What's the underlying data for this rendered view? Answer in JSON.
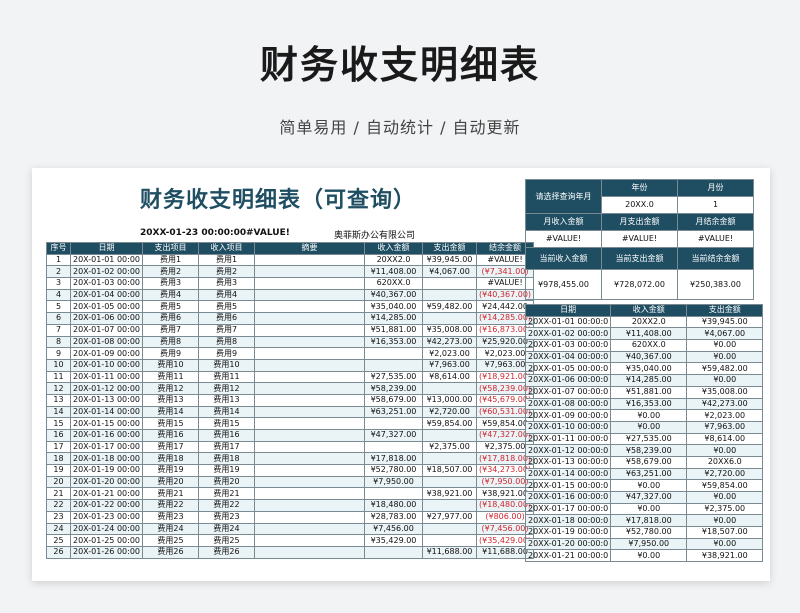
{
  "header": {
    "title": "财务收支明细表",
    "subtitle": "简单易用 / 自动统计 / 自动更新"
  },
  "sheet": {
    "title": "财务收支明细表（可查询）",
    "date": "20XX-01-23 00:00:00",
    "error": "#VALUE!",
    "company": "奥菲斯办公有限公司"
  },
  "main_headers": [
    "序号",
    "日期",
    "支出项目",
    "收入项目",
    "摘要",
    "收入金额",
    "支出金额",
    "结余金额"
  ],
  "rows": [
    {
      "no": "1",
      "date": "20X-01-01 00:00",
      "exp": "费用1",
      "inc": "费用1",
      "memo": "",
      "income": "20XX2.0",
      "expense": "¥39,945.00",
      "balance": "#VALUE!",
      "neg": false
    },
    {
      "no": "2",
      "date": "20X-01-02 00:00",
      "exp": "费用2",
      "inc": "费用2",
      "memo": "",
      "income": "¥11,408.00",
      "expense": "¥4,067.00",
      "balance": "(¥7,341.00)",
      "neg": true
    },
    {
      "no": "3",
      "date": "20X-01-03 00:00",
      "exp": "费用3",
      "inc": "费用3",
      "memo": "",
      "income": "620XX.0",
      "expense": "",
      "balance": "#VALUE!",
      "neg": false
    },
    {
      "no": "4",
      "date": "20X-01-04 00:00",
      "exp": "费用4",
      "inc": "费用4",
      "memo": "",
      "income": "¥40,367.00",
      "expense": "",
      "balance": "(¥40,367.00)",
      "neg": true
    },
    {
      "no": "5",
      "date": "20X-01-05 00:00",
      "exp": "费用5",
      "inc": "费用5",
      "memo": "",
      "income": "¥35,040.00",
      "expense": "¥59,482.00",
      "balance": "¥24,442.00",
      "neg": false
    },
    {
      "no": "6",
      "date": "20X-01-06 00:00",
      "exp": "费用6",
      "inc": "费用6",
      "memo": "",
      "income": "¥14,285.00",
      "expense": "",
      "balance": "(¥14,285.00)",
      "neg": true
    },
    {
      "no": "7",
      "date": "20X-01-07 00:00",
      "exp": "费用7",
      "inc": "费用7",
      "memo": "",
      "income": "¥51,881.00",
      "expense": "¥35,008.00",
      "balance": "(¥16,873.00)",
      "neg": true
    },
    {
      "no": "8",
      "date": "20X-01-08 00:00",
      "exp": "费用8",
      "inc": "费用8",
      "memo": "",
      "income": "¥16,353.00",
      "expense": "¥42,273.00",
      "balance": "¥25,920.00",
      "neg": false
    },
    {
      "no": "9",
      "date": "20X-01-09 00:00",
      "exp": "费用9",
      "inc": "费用9",
      "memo": "",
      "income": "",
      "expense": "¥2,023.00",
      "balance": "¥2,023.00",
      "neg": false
    },
    {
      "no": "10",
      "date": "20X-01-10 00:00",
      "exp": "费用10",
      "inc": "费用10",
      "memo": "",
      "income": "",
      "expense": "¥7,963.00",
      "balance": "¥7,963.00",
      "neg": false
    },
    {
      "no": "11",
      "date": "20X-01-11 00:00",
      "exp": "费用11",
      "inc": "费用11",
      "memo": "",
      "income": "¥27,535.00",
      "expense": "¥8,614.00",
      "balance": "(¥18,921.00)",
      "neg": true
    },
    {
      "no": "12",
      "date": "20X-01-12 00:00",
      "exp": "费用12",
      "inc": "费用12",
      "memo": "",
      "income": "¥58,239.00",
      "expense": "",
      "balance": "(¥58,239.00)",
      "neg": true
    },
    {
      "no": "13",
      "date": "20X-01-13 00:00",
      "exp": "费用13",
      "inc": "费用13",
      "memo": "",
      "income": "¥58,679.00",
      "expense": "¥13,000.00",
      "balance": "(¥45,679.00)",
      "neg": true
    },
    {
      "no": "14",
      "date": "20X-01-14 00:00",
      "exp": "费用14",
      "inc": "费用14",
      "memo": "",
      "income": "¥63,251.00",
      "expense": "¥2,720.00",
      "balance": "(¥60,531.00)",
      "neg": true
    },
    {
      "no": "15",
      "date": "20X-01-15 00:00",
      "exp": "费用15",
      "inc": "费用15",
      "memo": "",
      "income": "",
      "expense": "¥59,854.00",
      "balance": "¥59,854.00",
      "neg": false
    },
    {
      "no": "16",
      "date": "20X-01-16 00:00",
      "exp": "费用16",
      "inc": "费用16",
      "memo": "",
      "income": "¥47,327.00",
      "expense": "",
      "balance": "(¥47,327.00)",
      "neg": true
    },
    {
      "no": "17",
      "date": "20X-01-17 00:00",
      "exp": "费用17",
      "inc": "费用17",
      "memo": "",
      "income": "",
      "expense": "¥2,375.00",
      "balance": "¥2,375.00",
      "neg": false
    },
    {
      "no": "18",
      "date": "20X-01-18 00:00",
      "exp": "费用18",
      "inc": "费用18",
      "memo": "",
      "income": "¥17,818.00",
      "expense": "",
      "balance": "(¥17,818.00)",
      "neg": true
    },
    {
      "no": "19",
      "date": "20X-01-19 00:00",
      "exp": "费用19",
      "inc": "费用19",
      "memo": "",
      "income": "¥52,780.00",
      "expense": "¥18,507.00",
      "balance": "(¥34,273.00)",
      "neg": true
    },
    {
      "no": "20",
      "date": "20X-01-20 00:00",
      "exp": "费用20",
      "inc": "费用20",
      "memo": "",
      "income": "¥7,950.00",
      "expense": "",
      "balance": "(¥7,950.00)",
      "neg": true
    },
    {
      "no": "21",
      "date": "20X-01-21 00:00",
      "exp": "费用21",
      "inc": "费用21",
      "memo": "",
      "income": "",
      "expense": "¥38,921.00",
      "balance": "¥38,921.00",
      "neg": false
    },
    {
      "no": "22",
      "date": "20X-01-22 00:00",
      "exp": "费用22",
      "inc": "费用22",
      "memo": "",
      "income": "¥18,480.00",
      "expense": "",
      "balance": "(¥18,480.00)",
      "neg": true
    },
    {
      "no": "23",
      "date": "20X-01-23 00:00",
      "exp": "费用23",
      "inc": "费用23",
      "memo": "",
      "income": "¥28,783.00",
      "expense": "¥27,977.00",
      "balance": "(¥806.00)",
      "neg": true
    },
    {
      "no": "24",
      "date": "20X-01-24 00:00",
      "exp": "费用24",
      "inc": "费用24",
      "memo": "",
      "income": "¥7,456.00",
      "expense": "",
      "balance": "(¥7,456.00)",
      "neg": true
    },
    {
      "no": "25",
      "date": "20X-01-25 00:00",
      "exp": "费用25",
      "inc": "费用25",
      "memo": "",
      "income": "¥35,429.00",
      "expense": "",
      "balance": "(¥35,429.00)",
      "neg": true
    },
    {
      "no": "26",
      "date": "20X-01-26 00:00",
      "exp": "费用26",
      "inc": "费用26",
      "memo": "",
      "income": "",
      "expense": "¥11,688.00",
      "balance": "¥11,688.00",
      "neg": false
    }
  ],
  "query": {
    "label": "请选择查询年月",
    "year_label": "年份",
    "month_label": "月份",
    "year": "20XX.0",
    "month": "1",
    "month_income_label": "月收入金额",
    "month_expense_label": "月支出金额",
    "month_balance_label": "月结余金额",
    "month_income": "#VALUE!",
    "month_expense": "#VALUE!",
    "month_balance": "#VALUE!",
    "cur_income_label": "当前收入金额",
    "cur_expense_label": "当前支出金额",
    "cur_balance_label": "当前结余金额",
    "cur_income": "¥978,455.00",
    "cur_expense": "¥728,072.00",
    "cur_balance": "¥250,383.00"
  },
  "side_headers": [
    "日期",
    "收入金额",
    "支出金额"
  ],
  "side_rows": [
    {
      "date": "20XX-01-01 00:00:0",
      "income": "20XX2.0",
      "expense": "¥39,945.00"
    },
    {
      "date": "20XX-01-02 00:00:0",
      "income": "¥11,408.00",
      "expense": "¥4,067.00"
    },
    {
      "date": "20XX-01-03 00:00:0",
      "income": "620XX.0",
      "expense": "¥0.00"
    },
    {
      "date": "20XX-01-04 00:00:0",
      "income": "¥40,367.00",
      "expense": "¥0.00"
    },
    {
      "date": "20XX-01-05 00:00:0",
      "income": "¥35,040.00",
      "expense": "¥59,482.00"
    },
    {
      "date": "20XX-01-06 00:00:0",
      "income": "¥14,285.00",
      "expense": "¥0.00"
    },
    {
      "date": "20XX-01-07 00:00:0",
      "income": "¥51,881.00",
      "expense": "¥35,008.00"
    },
    {
      "date": "20XX-01-08 00:00:0",
      "income": "¥16,353.00",
      "expense": "¥42,273.00"
    },
    {
      "date": "20XX-01-09 00:00:0",
      "income": "¥0.00",
      "expense": "¥2,023.00"
    },
    {
      "date": "20XX-01-10 00:00:0",
      "income": "¥0.00",
      "expense": "¥7,963.00"
    },
    {
      "date": "20XX-01-11 00:00:0",
      "income": "¥27,535.00",
      "expense": "¥8,614.00"
    },
    {
      "date": "20XX-01-12 00:00:0",
      "income": "¥58,239.00",
      "expense": "¥0.00"
    },
    {
      "date": "20XX-01-13 00:00:0",
      "income": "¥58,679.00",
      "expense": "20XX6.0"
    },
    {
      "date": "20XX-01-14 00:00:0",
      "income": "¥63,251.00",
      "expense": "¥2,720.00"
    },
    {
      "date": "20XX-01-15 00:00:0",
      "income": "¥0.00",
      "expense": "¥59,854.00"
    },
    {
      "date": "20XX-01-16 00:00:0",
      "income": "¥47,327.00",
      "expense": "¥0.00"
    },
    {
      "date": "20XX-01-17 00:00:0",
      "income": "¥0.00",
      "expense": "¥2,375.00"
    },
    {
      "date": "20XX-01-18 00:00:0",
      "income": "¥17,818.00",
      "expense": "¥0.00"
    },
    {
      "date": "20XX-01-19 00:00:0",
      "income": "¥52,780.00",
      "expense": "¥18,507.00"
    },
    {
      "date": "20XX-01-20 00:00:0",
      "income": "¥7,950.00",
      "expense": "¥0.00"
    },
    {
      "date": "20XX-01-21 00:00:0",
      "income": "¥0.00",
      "expense": "¥38,921.00"
    }
  ],
  "colors": {
    "header_bg": "#1f4e63",
    "title": "#1f4e63",
    "negative": "#d0272f",
    "row_alt": "#eaf3f6"
  }
}
